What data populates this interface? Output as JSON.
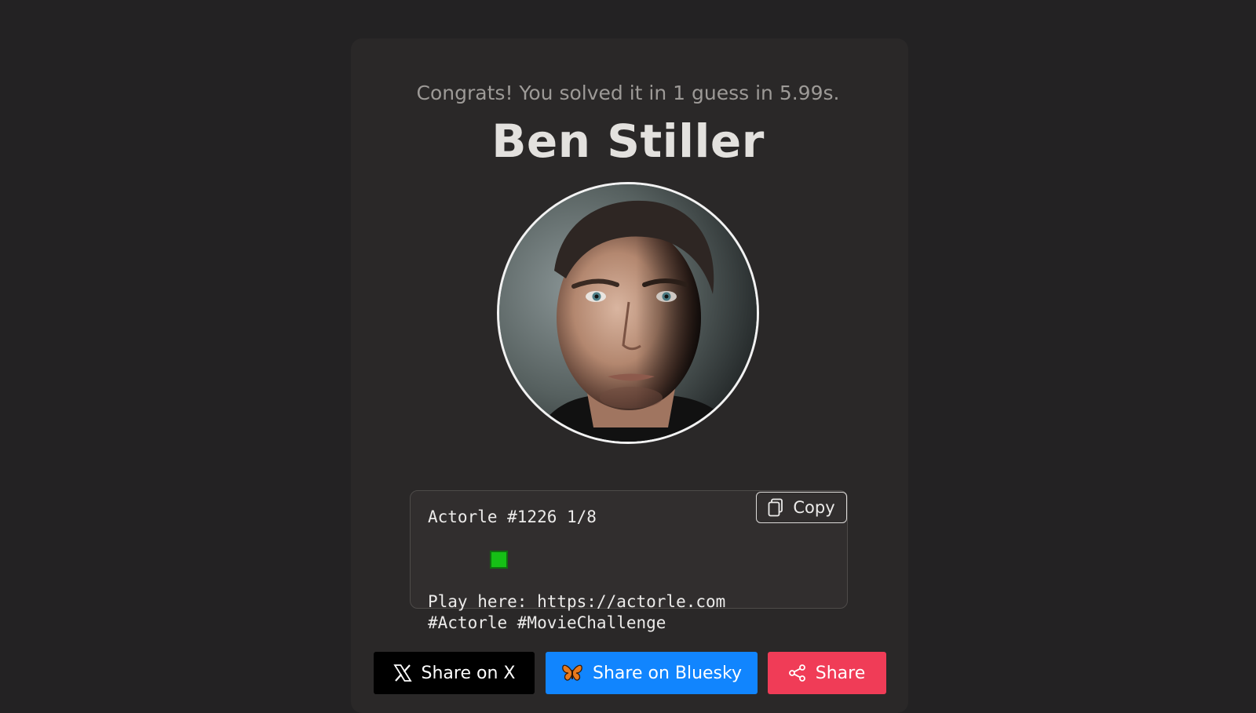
{
  "result": {
    "congrats_text": "Congrats! You solved it in 1 guess in 5.99s.",
    "actor_name": "Ben Stiller"
  },
  "share_box": {
    "lines": [
      "Actorle #1226 1/8",
      "Play here: https://actorle.com",
      "#Actorle #MovieChallenge"
    ],
    "guess_squares": [
      "correct"
    ],
    "square_color": "#16c016",
    "copy_label": "Copy"
  },
  "share_buttons": {
    "x_label": "Share on X",
    "bluesky_label": "Share on Bluesky",
    "share_label": "Share",
    "colors": {
      "x": "#000000",
      "bluesky": "#1185fe",
      "share": "#f03c57"
    }
  }
}
